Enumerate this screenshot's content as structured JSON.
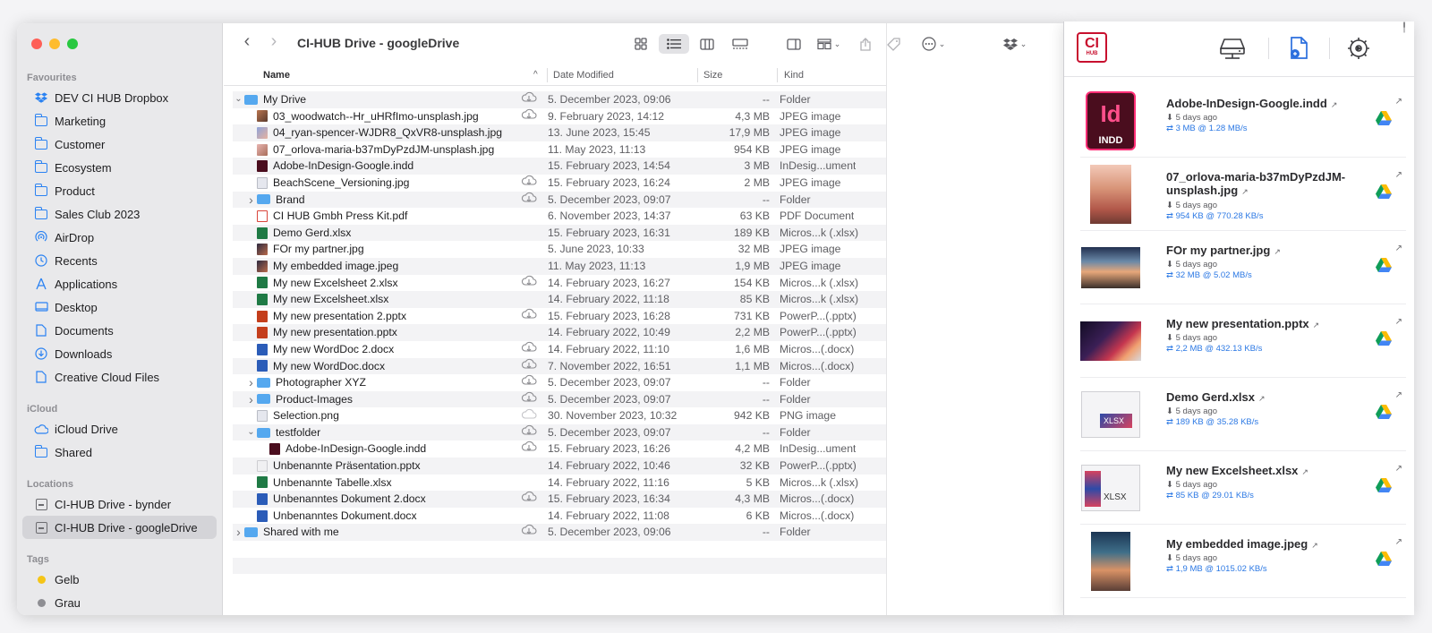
{
  "window_title": "CI-HUB Drive - googleDrive",
  "sidebar": {
    "sections": [
      {
        "heading": "Favourites",
        "items": [
          {
            "label": "DEV CI HUB Dropbox",
            "icon": "dropbox-icon"
          },
          {
            "label": "Marketing",
            "icon": "folder-icon"
          },
          {
            "label": "Customer",
            "icon": "folder-icon"
          },
          {
            "label": "Ecosystem",
            "icon": "folder-icon"
          },
          {
            "label": "Product",
            "icon": "folder-icon"
          },
          {
            "label": "Sales Club 2023",
            "icon": "folder-icon"
          },
          {
            "label": "AirDrop",
            "icon": "airdrop-icon"
          },
          {
            "label": "Recents",
            "icon": "clock-icon"
          },
          {
            "label": "Applications",
            "icon": "applications-icon"
          },
          {
            "label": "Desktop",
            "icon": "desktop-icon"
          },
          {
            "label": "Documents",
            "icon": "document-icon"
          },
          {
            "label": "Downloads",
            "icon": "download-icon"
          },
          {
            "label": "Creative Cloud Files",
            "icon": "file-icon"
          }
        ]
      },
      {
        "heading": "iCloud",
        "items": [
          {
            "label": "iCloud Drive",
            "icon": "cloud-icon"
          },
          {
            "label": "Shared",
            "icon": "shared-folder-icon"
          }
        ]
      },
      {
        "heading": "Locations",
        "items": [
          {
            "label": "CI-HUB Drive - bynder",
            "icon": "drive-icon"
          },
          {
            "label": "CI-HUB Drive - googleDrive",
            "icon": "drive-icon",
            "selected": true
          }
        ]
      },
      {
        "heading": "Tags",
        "items": [
          {
            "label": "Gelb",
            "icon": "tag-dot-icon",
            "color": "#f5c518"
          },
          {
            "label": "Grau",
            "icon": "tag-dot-icon",
            "color": "#8e8e93"
          }
        ]
      }
    ]
  },
  "columns": {
    "name": "Name",
    "date": "Date Modified",
    "size": "Size",
    "kind": "Kind"
  },
  "files": [
    {
      "name": "My Drive",
      "date": "5. December 2023, 09:06",
      "size": "--",
      "kind": "Folder",
      "icon": "folder",
      "indent": 0,
      "disclosure": "open",
      "cloud": "cloud-download"
    },
    {
      "name": "03_woodwatch--Hr_uHRfImo-unsplash.jpg",
      "date": "9. February 2023, 14:12",
      "size": "4,3 MB",
      "kind": "JPEG image",
      "icon": "jpg",
      "indent": 1,
      "cloud": "cloud-download"
    },
    {
      "name": "04_ryan-spencer-WJDR8_QxVR8-unsplash.jpg",
      "date": "13. June 2023, 15:45",
      "size": "17,9 MB",
      "kind": "JPEG image",
      "icon": "jpg2",
      "indent": 1,
      "cloud": ""
    },
    {
      "name": "07_orlova-maria-b37mDyPzdJM-unsplash.jpg",
      "date": "11. May 2023, 11:13",
      "size": "954 KB",
      "kind": "JPEG image",
      "icon": "jpg3",
      "indent": 1,
      "cloud": ""
    },
    {
      "name": "Adobe-InDesign-Google.indd",
      "date": "15. February 2023, 14:54",
      "size": "3 MB",
      "kind": "InDesig...ument",
      "icon": "indd",
      "indent": 1,
      "cloud": ""
    },
    {
      "name": "BeachScene_Versioning.jpg",
      "date": "15. February 2023, 16:24",
      "size": "2 MB",
      "kind": "JPEG image",
      "icon": "png",
      "indent": 1,
      "cloud": "cloud-download"
    },
    {
      "name": "Brand",
      "date": "5. December 2023, 09:07",
      "size": "--",
      "kind": "Folder",
      "icon": "folder",
      "indent": 1,
      "disclosure": "closed",
      "cloud": "cloud-download"
    },
    {
      "name": "CI HUB Gmbh Press Kit.pdf",
      "date": "6. November 2023, 14:37",
      "size": "63 KB",
      "kind": "PDF Document",
      "icon": "pdf",
      "indent": 1,
      "cloud": ""
    },
    {
      "name": "Demo Gerd.xlsx",
      "date": "15. February 2023, 16:31",
      "size": "189 KB",
      "kind": "Micros...k (.xlsx)",
      "icon": "xlsx",
      "indent": 1,
      "cloud": ""
    },
    {
      "name": "FOr my partner.jpg",
      "date": "5. June 2023, 10:33",
      "size": "32 MB",
      "kind": "JPEG image",
      "icon": "jpgdark",
      "indent": 1,
      "cloud": ""
    },
    {
      "name": "My embedded image.jpeg",
      "date": "11. May 2023, 11:13",
      "size": "1,9 MB",
      "kind": "JPEG image",
      "icon": "jpgdark",
      "indent": 1,
      "cloud": ""
    },
    {
      "name": "My new Excelsheet 2.xlsx",
      "date": "14. February 2023, 16:27",
      "size": "154 KB",
      "kind": "Micros...k (.xlsx)",
      "icon": "xlsx",
      "indent": 1,
      "cloud": "cloud-download"
    },
    {
      "name": "My new Excelsheet.xlsx",
      "date": "14. February 2022, 11:18",
      "size": "85 KB",
      "kind": "Micros...k (.xlsx)",
      "icon": "xlsx",
      "indent": 1,
      "cloud": ""
    },
    {
      "name": "My new presentation 2.pptx",
      "date": "15. February 2023, 16:28",
      "size": "731 KB",
      "kind": "PowerP...(.pptx)",
      "icon": "pptx",
      "indent": 1,
      "cloud": "cloud-download"
    },
    {
      "name": "My new presentation.pptx",
      "date": "14. February 2022, 10:49",
      "size": "2,2 MB",
      "kind": "PowerP...(.pptx)",
      "icon": "pptx",
      "indent": 1,
      "cloud": ""
    },
    {
      "name": "My new WordDoc 2.docx",
      "date": "14. February 2022, 11:10",
      "size": "1,6 MB",
      "kind": "Micros...(.docx)",
      "icon": "docx",
      "indent": 1,
      "cloud": "cloud-download"
    },
    {
      "name": "My new WordDoc.docx",
      "date": "7. November 2022, 16:51",
      "size": "1,1 MB",
      "kind": "Micros...(.docx)",
      "icon": "docx",
      "indent": 1,
      "cloud": "cloud-download"
    },
    {
      "name": "Photographer XYZ",
      "date": "5. December 2023, 09:07",
      "size": "--",
      "kind": "Folder",
      "icon": "folder",
      "indent": 1,
      "disclosure": "closed",
      "cloud": "cloud-download"
    },
    {
      "name": "Product-Images",
      "date": "5. December 2023, 09:07",
      "size": "--",
      "kind": "Folder",
      "icon": "folder",
      "indent": 1,
      "disclosure": "closed",
      "cloud": "cloud-download"
    },
    {
      "name": "Selection.png",
      "date": "30. November 2023, 10:32",
      "size": "942 KB",
      "kind": "PNG image",
      "icon": "png",
      "indent": 1,
      "cloud": "cloud"
    },
    {
      "name": "testfolder",
      "date": "5. December 2023, 09:07",
      "size": "--",
      "kind": "Folder",
      "icon": "folder",
      "indent": 1,
      "disclosure": "open",
      "cloud": "cloud-download"
    },
    {
      "name": "Adobe-InDesign-Google.indd",
      "date": "15. February 2023, 16:26",
      "size": "4,2 MB",
      "kind": "InDesig...ument",
      "icon": "indd",
      "indent": 2,
      "cloud": "cloud-download"
    },
    {
      "name": "Unbenannte Präsentation.pptx",
      "date": "14. February 2022, 10:46",
      "size": "32 KB",
      "kind": "PowerP...(.pptx)",
      "icon": "blank",
      "indent": 1,
      "cloud": ""
    },
    {
      "name": "Unbenannte Tabelle.xlsx",
      "date": "14. February 2022, 11:16",
      "size": "5 KB",
      "kind": "Micros...k (.xlsx)",
      "icon": "xlsx",
      "indent": 1,
      "cloud": ""
    },
    {
      "name": "Unbenanntes Dokument 2.docx",
      "date": "15. February 2023, 16:34",
      "size": "4,3 MB",
      "kind": "Micros...(.docx)",
      "icon": "docx",
      "indent": 1,
      "cloud": "cloud-download"
    },
    {
      "name": "Unbenanntes Dokument.docx",
      "date": "14. February 2022, 11:08",
      "size": "6 KB",
      "kind": "Micros...(.docx)",
      "icon": "docx",
      "indent": 1,
      "cloud": ""
    },
    {
      "name": "Shared with me",
      "date": "5. December 2023, 09:06",
      "size": "--",
      "kind": "Folder",
      "icon": "folder",
      "indent": 0,
      "disclosure": "closed",
      "cloud": "cloud-download"
    }
  ],
  "cihub": {
    "logo_big": "CI",
    "logo_small": "HUB",
    "items": [
      {
        "name": "Adobe-InDesign-Google.indd",
        "age": "⬇ 5 days ago",
        "speed": "⇄ 3 MB @ 1.28 MB/s",
        "thumb": "indd",
        "thumb_label_big": "Id",
        "thumb_label_small": "INDD"
      },
      {
        "name": "07_orlova-maria-b37mDyPzdJM-unsplash.jpg",
        "age": "⬇ 5 days ago",
        "speed": "⇄ 954 KB @ 770.28 KB/s",
        "thumb": "photo-corridor"
      },
      {
        "name": "FOr my partner.jpg",
        "age": "⬇ 5 days ago",
        "speed": "⇄ 32 MB @ 5.02 MB/s",
        "thumb": "photo-beach"
      },
      {
        "name": "My new presentation.pptx",
        "age": "⬇ 5 days ago",
        "speed": "⇄ 2,2 MB @ 432.13 KB/s",
        "thumb": "photo-laptop"
      },
      {
        "name": "Demo Gerd.xlsx",
        "age": "⬇ 5 days ago",
        "speed": "⇄ 189 KB @ 35.28 KB/s",
        "thumb": "xlsx",
        "thumb_label_small": "XLSX"
      },
      {
        "name": "My new Excelsheet.xlsx",
        "age": "⬇ 5 days ago",
        "speed": "⇄ 85 KB @ 29.01 KB/s",
        "thumb": "xlsx2",
        "thumb_label_small": "XLSX"
      },
      {
        "name": "My embedded image.jpeg",
        "age": "⬇ 5 days ago",
        "speed": "⇄ 1,9 MB @ 1015.02 KB/s",
        "thumb": "photo-sunset"
      }
    ]
  }
}
